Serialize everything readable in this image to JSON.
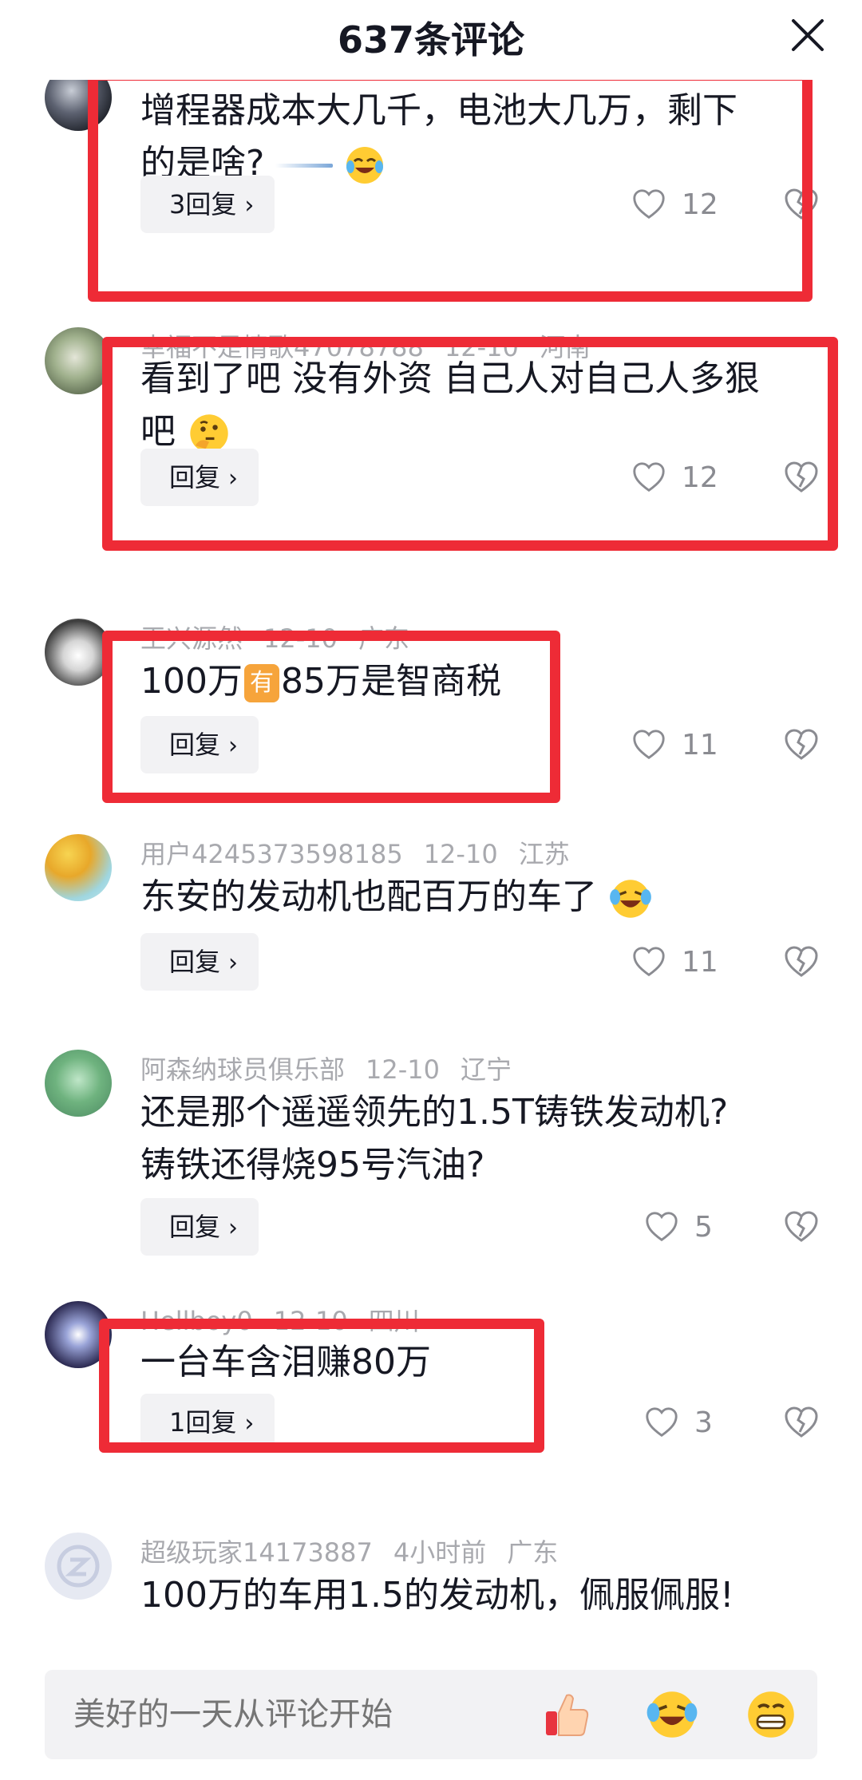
{
  "header": {
    "title": "637条评论"
  },
  "comments": [
    {
      "text_a": "增程器成本大几千，电池大几万，剩下",
      "text_b": "的是啥?",
      "reply_label": "3回复",
      "likes": "12"
    },
    {
      "meta_user": "幸福不是情歌47078788",
      "meta_date": "12-10",
      "meta_region": "河南",
      "text_a": "看到了吧 没有外资 自己人对自己人多狠",
      "text_b": "吧",
      "reply_label": "回复",
      "likes": "12"
    },
    {
      "meta_user": "王兴源然",
      "meta_date": "12-10",
      "meta_region": "广东",
      "text_a": "100万",
      "badge": "有",
      "text_b": "85万是智商税",
      "reply_label": "回复",
      "likes": "11"
    },
    {
      "meta_user": "用户4245373598185",
      "meta_date": "12-10",
      "meta_region": "江苏",
      "text_a": "东安的发动机也配百万的车了",
      "reply_label": "回复",
      "likes": "11"
    },
    {
      "meta_user": "阿森纳球员俱乐部",
      "meta_date": "12-10",
      "meta_region": "辽宁",
      "text_a": "还是那个遥遥领先的1.5T铸铁发动机?",
      "text_b": "铸铁还得烧95号汽油?",
      "reply_label": "回复",
      "likes": "5"
    },
    {
      "meta_user": "Hellboy0",
      "meta_date": "12-10",
      "meta_region": "四川",
      "text_a": "一台车含泪赚80万",
      "reply_label": "1回复",
      "likes": "3"
    },
    {
      "meta_user": "超级玩家14173887",
      "meta_date": "4小时前",
      "meta_region": "广东",
      "text_a": "100万的车用1.5的发动机，佩服佩服!"
    }
  ],
  "input": {
    "placeholder": "美好的一天从评论开始"
  },
  "icons": {
    "close": "close-icon",
    "like": "heart-icon",
    "dislike": "broken-heart-icon",
    "reply_chevron": "chevron-right-icon",
    "quick_emojis": [
      "thumbs-up-icon",
      "crying-laughing-icon",
      "grinning-icon"
    ]
  },
  "colors": {
    "highlight": "#ee2b36",
    "reply_bg": "#f2f2f4",
    "meta_text": "#a8a9ae",
    "badge": "#f6a43b"
  }
}
